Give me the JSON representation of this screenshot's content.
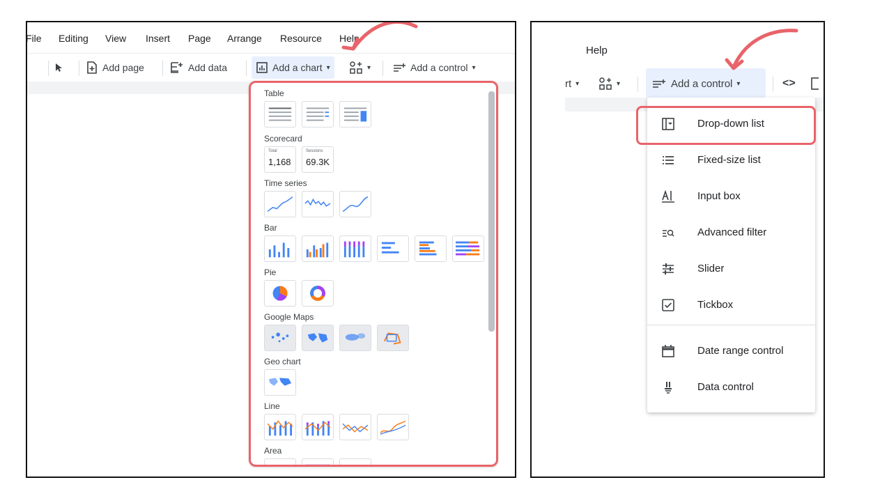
{
  "left": {
    "menu": [
      "File",
      "Editing",
      "View",
      "Insert",
      "Page",
      "Arrange",
      "Resource",
      "Help"
    ],
    "toolbar": {
      "add_page": "Add page",
      "add_data": "Add data",
      "add_chart": "Add a chart",
      "add_control": "Add a control"
    },
    "chart_menu": {
      "categories": [
        "Table",
        "Scorecard",
        "Time series",
        "Bar",
        "Pie",
        "Google Maps",
        "Geo chart",
        "Line",
        "Area"
      ],
      "scorecards": [
        {
          "label": "Total",
          "value": "1,168"
        },
        {
          "label": "Sessions",
          "value": "69.3K"
        }
      ]
    }
  },
  "right": {
    "menu_help": "Help",
    "toolbar_partial": "rt",
    "add_control": "Add a control",
    "controls": [
      {
        "label": "Drop-down list",
        "icon": "dropdown-list-icon"
      },
      {
        "label": "Fixed-size list",
        "icon": "fixed-list-icon"
      },
      {
        "label": "Input box",
        "icon": "input-box-icon"
      },
      {
        "label": "Advanced filter",
        "icon": "advanced-filter-icon"
      },
      {
        "label": "Slider",
        "icon": "slider-icon"
      },
      {
        "label": "Tickbox",
        "icon": "tickbox-icon"
      },
      {
        "label": "Date range control",
        "icon": "calendar-icon"
      },
      {
        "label": "Data control",
        "icon": "data-control-icon"
      }
    ]
  },
  "colors": {
    "highlight": "#e8646a",
    "accent_blue": "#4285f4",
    "accent_orange": "#fa7b17",
    "accent_purple": "#a142f4",
    "toolbar_active": "#e8f0fe"
  }
}
